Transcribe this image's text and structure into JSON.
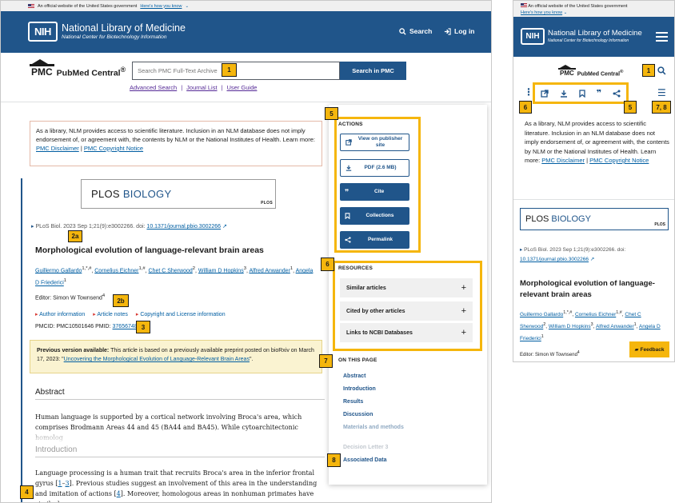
{
  "gov_banner": {
    "text": "An official website of the United States government",
    "link": "Here's how you know"
  },
  "header": {
    "logo": "NIH",
    "title": "National Library of Medicine",
    "subtitle": "National Center for Biotechnology Information",
    "search_label": "Search",
    "login_label": "Log in"
  },
  "pmc": {
    "logo_abbr": "PMC",
    "logo_name": "PubMed Central",
    "logo_mark": "®",
    "search_placeholder": "Search PMC Full-Text Archive",
    "search_button": "Search in PMC",
    "links": [
      "Advanced Search",
      "Journal List",
      "User Guide"
    ],
    "separator": "|"
  },
  "notice": {
    "text": "As a library, NLM provides access to scientific literature. Inclusion in an NLM database does not imply endorsement of, or agreement with, the contents by NLM or the National Institutes of Health.",
    "learn_more": "Learn more:",
    "link1": "PMC Disclaimer",
    "link2": "PMC Copyright Notice"
  },
  "journal": {
    "name_a": "PLOS",
    "name_b": "BIOLOGY",
    "mini": "PLOS"
  },
  "citation": {
    "text": "PLoS Biol. 2023 Sep 1;21(9):e3002266. doi:",
    "doi": "10.1371/journal.pbio.3002266"
  },
  "article": {
    "title": "Morphological evolution of language-relevant brain areas",
    "authors": [
      {
        "name": "Guillermo Gallardo",
        "sup": "1,*,#"
      },
      {
        "name": "Cornelius Eichner",
        "sup": "1,#"
      },
      {
        "name": "Chet C Sherwood",
        "sup": "2"
      },
      {
        "name": "William D Hopkins",
        "sup": "3"
      },
      {
        "name": "Alfred Anwander",
        "sup": "1"
      },
      {
        "name": "Angela D Friederici",
        "sup": "1"
      }
    ],
    "editor": "Editor: Simon W Townsend",
    "editor_sup": "4",
    "meta_links": [
      "Author information",
      "Article notes",
      "Copyright and License information"
    ],
    "pmcid": "PMCID: PMC10501646",
    "pmid_label": "PMID:",
    "pmid": "37656748",
    "prev_label": "Previous version available:",
    "prev_text": "This article is based on a previously available preprint posted on bioRxiv on March 17, 2023:",
    "prev_link": "Uncovering the Morphological Evolution of Language-Relevant Brain Areas",
    "abstract_h": "Abstract",
    "abstract_text": "Human language is supported by a cortical network involving Broca's area, which comprises Brodmann Areas 44 and 45 (BA44 and BA45). While cytoarchitectonic homolog",
    "intro_h": "Introduction",
    "intro_text_1": "Language processing is a human trait that recruits Broca's area in the inferior frontal gyrus",
    "intro_ref1": "1",
    "intro_dash": "–",
    "intro_ref2": "3",
    "intro_text_2": ". Previous studies suggest an involvement of this area in the understanding and imitation of actions",
    "intro_ref3": "4",
    "intro_text_3": ". Moreover, homologous areas in nonhuman primates have similarly"
  },
  "sidebar": {
    "actions_h": "ACTIONS",
    "actions": [
      {
        "label": "View on publisher site",
        "icon": "external-link-icon"
      },
      {
        "label": "PDF (2.6 MB)",
        "icon": "download-icon"
      },
      {
        "label": "Cite",
        "icon": "quote-icon"
      },
      {
        "label": "Collections",
        "icon": "bookmark-icon"
      },
      {
        "label": "Permalink",
        "icon": "share-icon"
      }
    ],
    "resources_h": "RESOURCES",
    "resources": [
      "Similar articles",
      "Cited by other articles",
      "Links to NCBI Databases"
    ],
    "otp_h": "ON THIS PAGE",
    "otp": [
      "Abstract",
      "Introduction",
      "Results",
      "Discussion",
      "Materials and methods",
      "Decision Letter 3",
      "Associated Data"
    ]
  },
  "markers": {
    "m1": "1",
    "m2a": "2a",
    "m2b": "2b",
    "m3": "3",
    "m4": "4",
    "m5": "5",
    "m6": "6",
    "m7": "7",
    "m8": "8",
    "m78": "7, 8"
  },
  "mobile": {
    "banner_text": "An official website of the United States government",
    "banner_link": "Here's how you know",
    "feedback": "Feedback"
  },
  "colors": {
    "nih_blue": "#20558a",
    "callout": "#f5b60d",
    "link": "#005ea2",
    "visited": "#562b97"
  }
}
